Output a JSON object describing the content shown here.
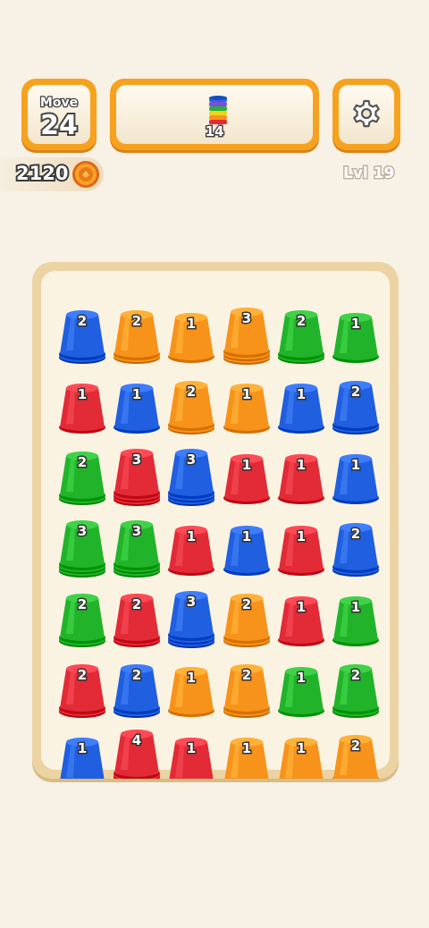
{
  "move": {
    "label": "Move",
    "value": "24"
  },
  "goal": {
    "count": "14"
  },
  "coins": {
    "value": "2120"
  },
  "level": {
    "label": "Lvl 19"
  },
  "colors": {
    "blue": "#1f5fe0",
    "orange": "#f7931a",
    "green": "#21b42a",
    "red": "#e22b37"
  },
  "icons": {
    "settings": "gear-icon",
    "coin": "coin-icon",
    "goal": "rainbow-cup-stack-icon"
  },
  "grid": [
    [
      {
        "c": "blue",
        "n": 2
      },
      {
        "c": "orange",
        "n": 2
      },
      {
        "c": "orange",
        "n": 1
      },
      {
        "c": "orange",
        "n": 3
      },
      {
        "c": "green",
        "n": 2
      },
      {
        "c": "green",
        "n": 1
      }
    ],
    [
      {
        "c": "red",
        "n": 1
      },
      {
        "c": "blue",
        "n": 1
      },
      {
        "c": "orange",
        "n": 2
      },
      {
        "c": "orange",
        "n": 1
      },
      {
        "c": "blue",
        "n": 1
      },
      {
        "c": "blue",
        "n": 2
      }
    ],
    [
      {
        "c": "green",
        "n": 2
      },
      {
        "c": "red",
        "n": 3
      },
      {
        "c": "blue",
        "n": 3
      },
      {
        "c": "red",
        "n": 1
      },
      {
        "c": "red",
        "n": 1
      },
      {
        "c": "blue",
        "n": 1
      }
    ],
    [
      {
        "c": "green",
        "n": 3
      },
      {
        "c": "green",
        "n": 3
      },
      {
        "c": "red",
        "n": 1
      },
      {
        "c": "blue",
        "n": 1
      },
      {
        "c": "red",
        "n": 1
      },
      {
        "c": "blue",
        "n": 2
      }
    ],
    [
      {
        "c": "green",
        "n": 2
      },
      {
        "c": "red",
        "n": 2
      },
      {
        "c": "blue",
        "n": 3
      },
      {
        "c": "orange",
        "n": 2
      },
      {
        "c": "red",
        "n": 1
      },
      {
        "c": "green",
        "n": 1
      }
    ],
    [
      {
        "c": "red",
        "n": 2
      },
      {
        "c": "blue",
        "n": 2
      },
      {
        "c": "orange",
        "n": 1
      },
      {
        "c": "orange",
        "n": 2
      },
      {
        "c": "green",
        "n": 1
      },
      {
        "c": "green",
        "n": 2
      }
    ],
    [
      {
        "c": "blue",
        "n": 1
      },
      {
        "c": "red",
        "n": 4
      },
      {
        "c": "red",
        "n": 1
      },
      {
        "c": "orange",
        "n": 1
      },
      {
        "c": "orange",
        "n": 1
      },
      {
        "c": "orange",
        "n": 2
      }
    ]
  ]
}
